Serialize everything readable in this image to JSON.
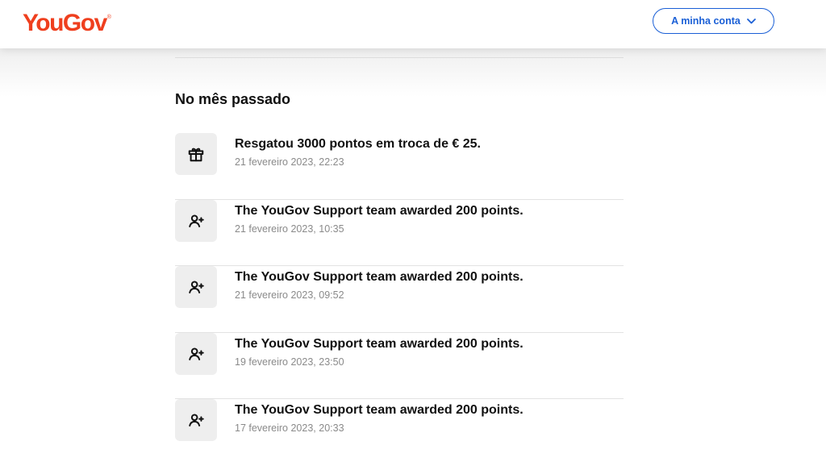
{
  "header": {
    "logo": "YouGov",
    "logo_mark": "®",
    "account_button": "A minha conta",
    "account_icon": "chevron-down-icon"
  },
  "section": {
    "title": "No mês passado"
  },
  "activity": [
    {
      "icon": "gift-icon",
      "title": "Resgatou 3000 pontos em troca de € 25.",
      "date": "21 fevereiro 2023, 22:23"
    },
    {
      "icon": "user-plus-icon",
      "title": "The YouGov Support team awarded 200 points.",
      "date": "21 fevereiro 2023, 10:35"
    },
    {
      "icon": "user-plus-icon",
      "title": "The YouGov Support team awarded 200 points.",
      "date": "21 fevereiro 2023, 09:52"
    },
    {
      "icon": "user-plus-icon",
      "title": "The YouGov Support team awarded 200 points.",
      "date": "19 fevereiro 2023, 23:50"
    },
    {
      "icon": "user-plus-icon",
      "title": "The YouGov Support team awarded 200 points.",
      "date": "17 fevereiro 2023, 20:33"
    }
  ],
  "colors": {
    "brand": "#ef3f1e",
    "accent": "#1a5fd6",
    "muted_text": "#8a8a8a"
  }
}
